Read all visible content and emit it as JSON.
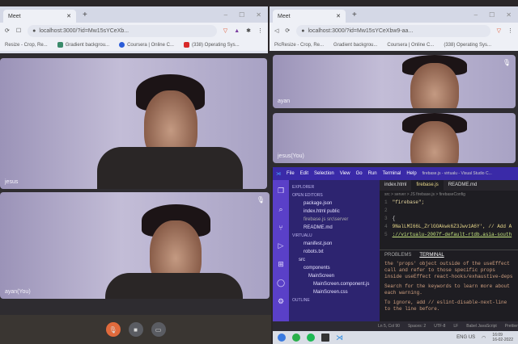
{
  "left_browser": {
    "tab_title": "Meet",
    "url": "localhost:3000/?id=Mw15sYCeXb...",
    "bookmarks": [
      "Resize - Crop, Re...",
      "Gradient backgrou...",
      "Coursera | Online C...",
      "(338) Operating Sys..."
    ]
  },
  "left_tiles": [
    {
      "name": "jesus"
    },
    {
      "name": "ayan(You)"
    }
  ],
  "right_browser": {
    "tab_title": "Meet",
    "url": "localhost:3000/?id=Mw15sYCeXbw9-aa...",
    "bookmarks": [
      "PicResize - Crop, Re...",
      "Gradient backgrou...",
      "Coursera | Online C...",
      "(338) Operating Sys..."
    ]
  },
  "right_tiles": [
    {
      "name": "ayan"
    },
    {
      "name": "jesus(You)"
    }
  ],
  "controls": {
    "mic": "mic-off-icon",
    "video": "video-icon",
    "screen": "screen-share-icon",
    "mic_color": "#e06a3c"
  },
  "vscode": {
    "menu": [
      "File",
      "Edit",
      "Selection",
      "View",
      "Go",
      "Run",
      "Terminal",
      "Help"
    ],
    "title": "firebase.js - virtualu - Visual Studio C...",
    "explorer": "EXPLORER",
    "open_editors": "OPEN EDITORS",
    "open_files": [
      "package.json",
      "index.html public",
      "firebase.js src\\server",
      "README.md"
    ],
    "project": "VIRTUALU",
    "tree": [
      "manifest.json",
      "robots.txt",
      "src",
      "components",
      "MainScreen",
      "MainScreen.component.js",
      "MainScreen.css"
    ],
    "outline": "OUTLINE",
    "tabs": [
      "index.html",
      "firebase.js",
      "README.md"
    ],
    "breadcrumb": "src > server > JS firebase.js > firebaseConfig",
    "code": [
      "\"firebase\";",
      "",
      "{",
      "9NalLMI66L_ZrlGOAkwk6Z3Jwv1A6Y', // Add A",
      "://virtualu-2007f-default-rtdb.asia-south"
    ],
    "line_numbers": [
      "1",
      "2",
      "3",
      "4",
      "5"
    ],
    "panel_tabs": [
      "PROBLEMS",
      "TERMINAL"
    ],
    "terminal": [
      "the 'props' object outside of the useEffect call and refer to those specific props inside useEffect  react-hooks/exhaustive-deps",
      "Search for the keywords to learn more about each warning.",
      "To ignore, add // eslint-disable-next-line to the line before."
    ],
    "status": [
      "Ln 5, Col 90",
      "Spaces: 2",
      "UTF-8",
      "LF",
      "Babel JavaScript",
      "Prettier"
    ]
  },
  "taskbar": {
    "lang": "ENG US",
    "time": "16:09",
    "date": "16-02-2022"
  }
}
